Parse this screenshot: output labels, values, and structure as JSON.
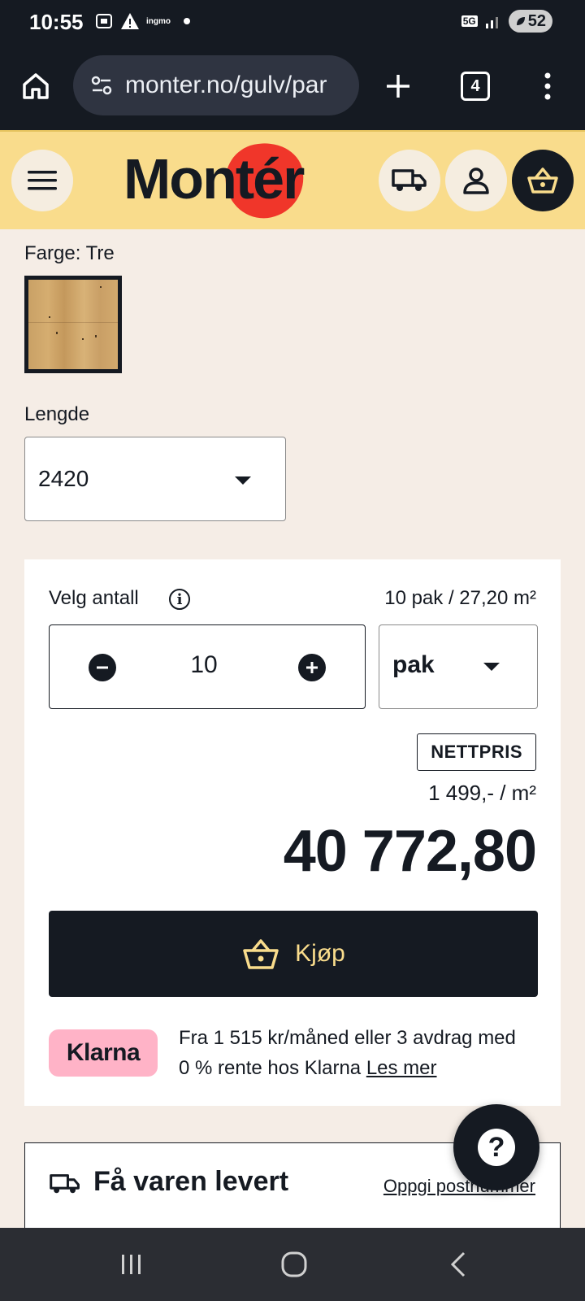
{
  "status_bar": {
    "time": "10:55",
    "carrier_label": "ingmo",
    "network": "5G",
    "battery": "52"
  },
  "browser": {
    "url": "monter.no/gulv/par",
    "tab_count": "4"
  },
  "header": {
    "logo_text": "Montér",
    "brand_color": "#f0362a",
    "accent_color": "#f9dc8c"
  },
  "product": {
    "color_label": "Farge: Tre",
    "length_label": "Lengde",
    "length_value": "2420"
  },
  "purchase": {
    "quantity_label": "Velg antall",
    "quantity_summary": "10 pak / 27,20 m²",
    "quantity_value": "10",
    "unit_value": "pak",
    "net_price_badge": "NETTPRIS",
    "unit_price": "1 499,- / m²",
    "total_price": "40 772,80",
    "buy_label": "Kjøp"
  },
  "klarna": {
    "badge": "Klarna",
    "text": "Fra 1 515 kr/måned eller 3 avdrag med 0 % rente hos Klarna",
    "link": "Les mer"
  },
  "delivery": {
    "title": "Få varen levert",
    "link": "Oppgi postnummer"
  },
  "icons": [
    "home-icon",
    "site-settings-icon",
    "plus-icon",
    "tabs-icon",
    "more-vert-icon",
    "menu-icon",
    "truck-icon",
    "user-icon",
    "basket-icon",
    "info-icon",
    "minus-icon",
    "help-icon"
  ]
}
